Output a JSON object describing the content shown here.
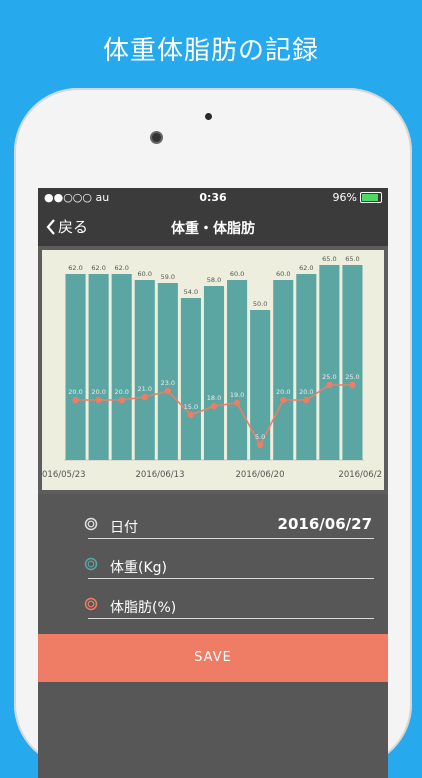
{
  "headline": "体重体脂肪の記録",
  "status": {
    "carrier": "●●○○○ au",
    "time": "0:36",
    "battery": "96%"
  },
  "nav": {
    "back": "戻る",
    "title": "体重・体脂肪"
  },
  "chart_data": {
    "type": "bar",
    "bar_series_values": [
      62.0,
      62.0,
      62.0,
      60.0,
      59.0,
      54.0,
      58.0,
      60.0,
      50.0,
      60.0,
      62.0,
      65.0,
      65.0
    ],
    "bar_labels": [
      "62.0",
      "62.0",
      "62.0",
      "60.0",
      "59.0",
      "54.0",
      "58.0",
      "60.0",
      "50.0",
      "60.0",
      "62.0",
      "65.0",
      "65.0"
    ],
    "line_series_values": [
      20.0,
      20.0,
      20.0,
      21.0,
      23.0,
      15.0,
      18.0,
      19.0,
      5.0,
      20.0,
      20.0,
      25.0,
      25.0
    ],
    "line_labels": [
      "20.0",
      "20.0",
      "20.0",
      "21.0",
      "23.0",
      "15.0",
      "18.0",
      "19.0",
      "5.0",
      "20.0",
      "20.0",
      "25.0",
      "25.0"
    ],
    "x_tick_labels": [
      "016/05/23",
      "2016/06/13",
      "2016/06/20",
      "2016/06/2"
    ],
    "bar_color": "#5ba6a2",
    "line_color": "#ef7d66",
    "grid": false
  },
  "form": {
    "date_label": "日付",
    "date_value": "2016/06/27",
    "weight_label": "体重(Kg)",
    "fat_label": "体脂肪(%)",
    "save_label": "SAVE"
  }
}
